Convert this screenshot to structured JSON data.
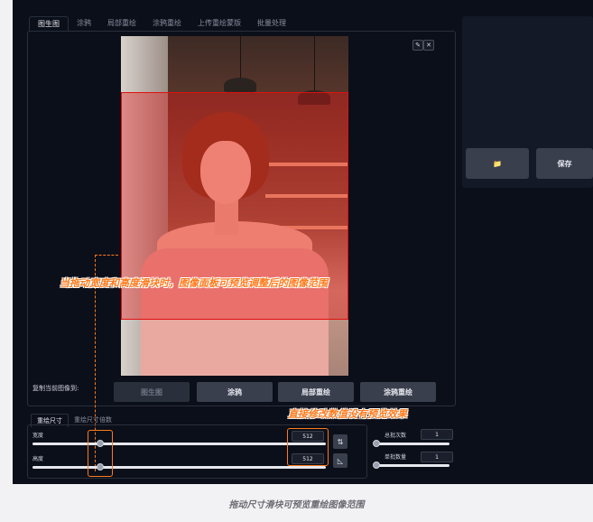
{
  "tabs": [
    "图生图",
    "涂鸦",
    "局部重绘",
    "涂鸦重绘",
    "上传重绘蒙版",
    "批量处理"
  ],
  "canvas_tools": {
    "edit_icon": "✎",
    "close_icon": "✕"
  },
  "annotations": {
    "overlay_note": "当拖动宽度和高度滑块时，图像面板可预览调整后的图像范围",
    "input_note": "直接修改数值没有预览效果"
  },
  "copy_to": {
    "label": "复制当前图像到:",
    "buttons": [
      "图生图",
      "涂鸦",
      "局部重绘",
      "涂鸦重绘"
    ]
  },
  "size_tabs": [
    "重绘尺寸",
    "重绘尺寸倍数"
  ],
  "size": {
    "width_label": "宽度",
    "width_value": "512",
    "height_label": "高度",
    "height_value": "512",
    "swap_icon": "⇅",
    "ratio_icon": "◺"
  },
  "batch": {
    "count_label": "总批次数",
    "count_value": "1",
    "size_label": "单批数量",
    "size_value": "1"
  },
  "right_panel": {
    "folder_icon": "📁",
    "save_label": "保存"
  },
  "caption": "拖动尺寸滑块可预览重绘图像范围",
  "colors": {
    "annotation": "#ff7a1a",
    "overlay": "#eb1414",
    "background": "#0b0f19"
  }
}
